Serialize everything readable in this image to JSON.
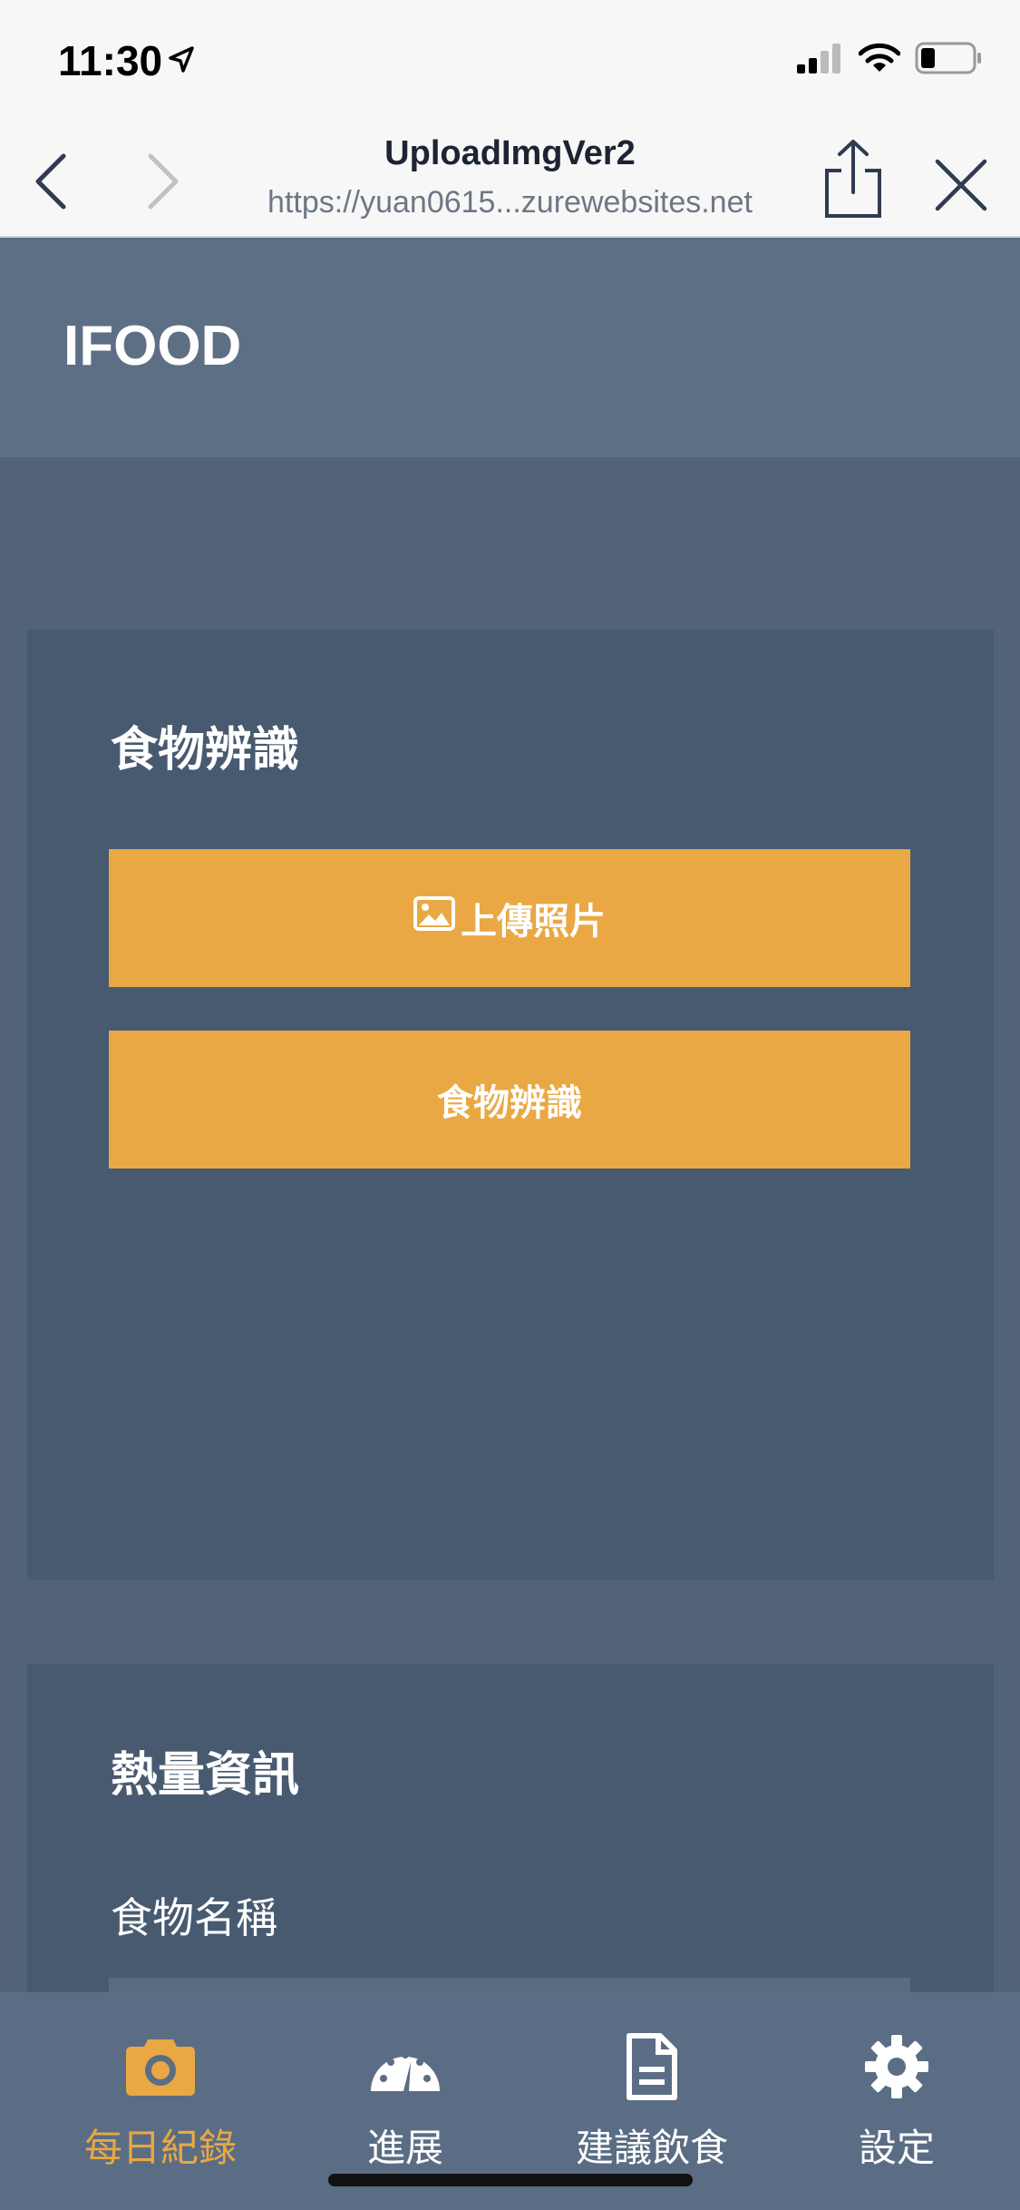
{
  "status_bar": {
    "time": "11:30"
  },
  "browser": {
    "title": "UploadImgVer2",
    "url": "https://yuan0615...zurewebsites.net"
  },
  "app": {
    "title": "IFOOD"
  },
  "recognition_card": {
    "title": "食物辨識",
    "upload_button": "上傳照片",
    "recognize_button": "食物辨識"
  },
  "calorie_card": {
    "title": "熱量資訊",
    "food_name_label": "食物名稱"
  },
  "tab_bar": {
    "tabs": [
      {
        "label": "每日紀錄",
        "icon": "camera-icon",
        "active": true
      },
      {
        "label": "進展",
        "icon": "gauge-icon",
        "active": false
      },
      {
        "label": "建議飲食",
        "icon": "document-icon",
        "active": false
      },
      {
        "label": "設定",
        "icon": "gear-icon",
        "active": false
      }
    ],
    "active_color": "#e9a843"
  },
  "colors": {
    "accent": "#e9a843",
    "header": "#5d6f84",
    "card": "#485a70",
    "background": "#526379"
  }
}
